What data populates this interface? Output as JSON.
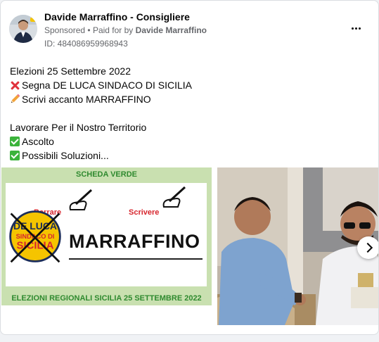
{
  "post": {
    "author": "Davide Marraffino - Consigliere",
    "sponsored": "Sponsored",
    "paid_for_prefix": "Paid for by",
    "paid_for_by": "Davide Marraffino",
    "id_label": "ID: 484086959968943",
    "more_icon": "more-horizontal-icon",
    "lines": [
      {
        "icon": "",
        "text": "Elezioni 25 Settembre 2022"
      },
      {
        "icon": "cross-mark-icon",
        "text": "Segna DE LUCA SINDACO DI SICILIA"
      },
      {
        "icon": "pencil-icon",
        "text": "Scrivi accanto MARRAFFINO"
      },
      {
        "icon": "",
        "text": ""
      },
      {
        "icon": "",
        "text": "Lavorare Per il Nostro Territorio"
      },
      {
        "icon": "check-mark-icon",
        "text": "Ascolto"
      },
      {
        "icon": "check-mark-icon",
        "text": "Possibili Soluzioni..."
      }
    ]
  },
  "ballot_image": {
    "header": "SCHEDA VERDE",
    "barrare": "Barrare",
    "scrivere": "Scrivere",
    "logo_line1": "DE LUCA",
    "logo_line2": "SINDACO DI",
    "logo_line3": "SICILIA",
    "candidate": "MARRAFFINO",
    "footer": "ELEZIONI REGIONALI SICILIA 25 SETTEMBRE 2022",
    "colors": {
      "green": "#2f8a2f",
      "red": "#d7262e",
      "yellow": "#f5c400",
      "background": "#c9e0b0"
    }
  },
  "carousel": {
    "next_icon": "chevron-right-icon"
  }
}
